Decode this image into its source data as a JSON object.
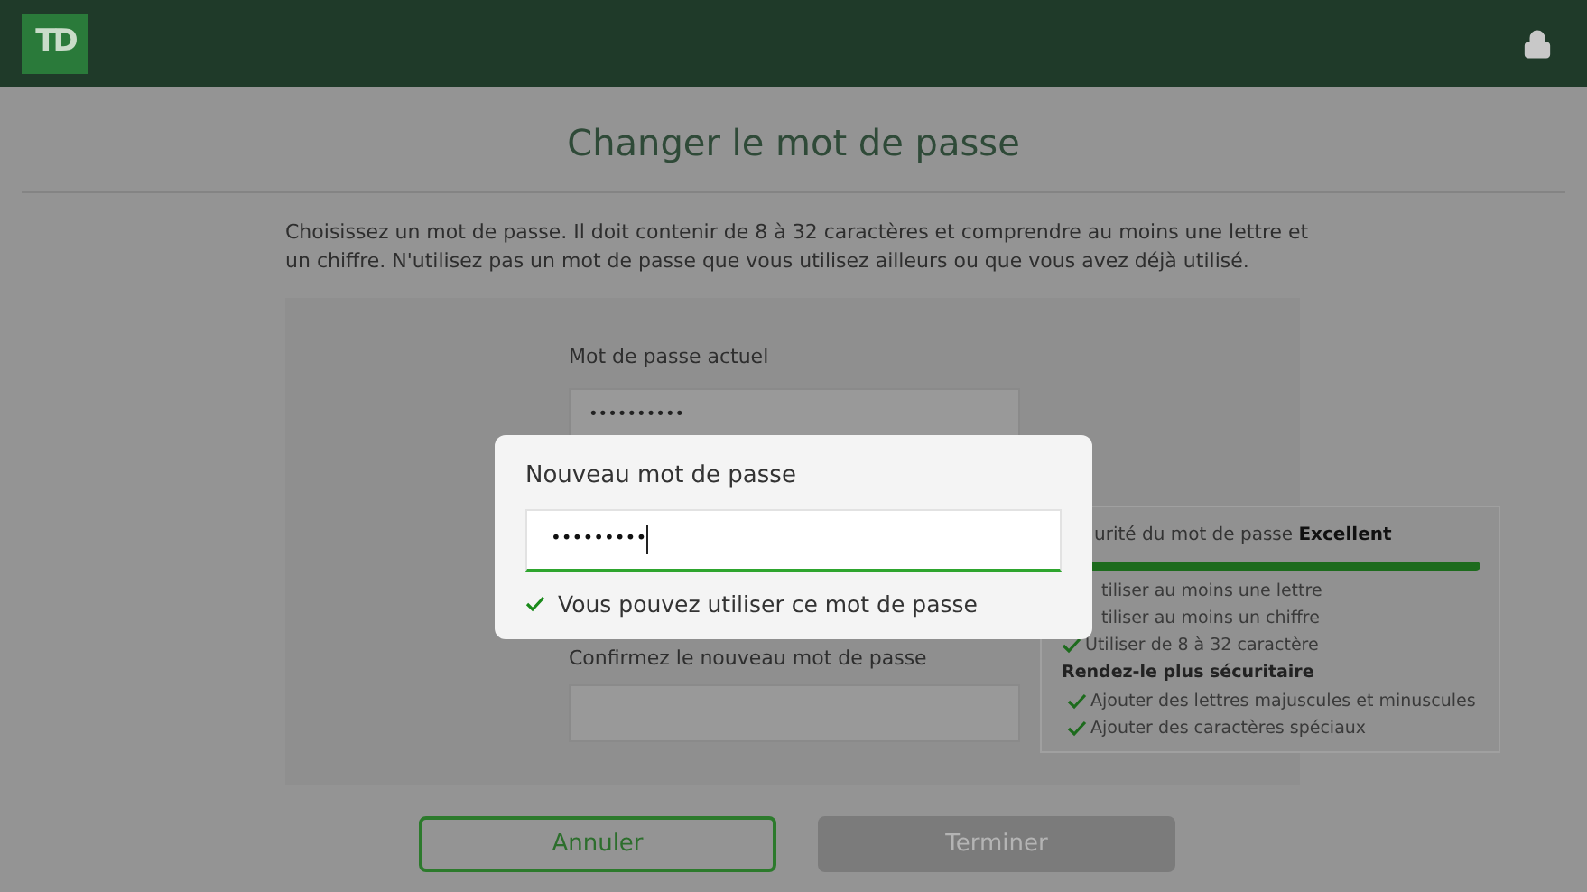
{
  "header": {
    "logo": "TD"
  },
  "title": "Changer le mot de passe",
  "intro": "Choisissez un mot de passe. Il doit contenir de 8 à 32 caractères et comprendre au moins une lettre et un chiffre. N'utilisez pas un mot de passe que vous utilisez ailleurs ou que vous avez déjà utilisé.",
  "current_password": {
    "label": "Mot de passe actuel",
    "value": "••••••••••"
  },
  "new_password": {
    "label": "Nouveau mot de passe",
    "value": "•••••••••",
    "valid": true,
    "message": "Vous pouvez utiliser ce mot de passe"
  },
  "confirm_password": {
    "label": "Confirmez le nouveau mot de passe"
  },
  "strength": {
    "title": "urité du mot de passe",
    "rating": "Excellent",
    "level": 1,
    "rules": [
      {
        "text": "tiliser au moins une lettre"
      },
      {
        "text": "tiliser au moins un chiffre"
      },
      {
        "text": "Utiliser de 8 à 32 caractère",
        "met": true
      }
    ],
    "subheading": "Rendez-le plus sécuritaire",
    "tips": [
      {
        "text": "Ajouter des lettres majuscules et minuscules",
        "met": true
      },
      {
        "text": "Ajouter des caractères spéciaux",
        "met": true
      }
    ]
  },
  "buttons": [
    {
      "label": "Annuler",
      "kind": "secondary",
      "disabled": false
    },
    {
      "label": "Terminer",
      "kind": "primary",
      "disabled": true
    }
  ]
}
